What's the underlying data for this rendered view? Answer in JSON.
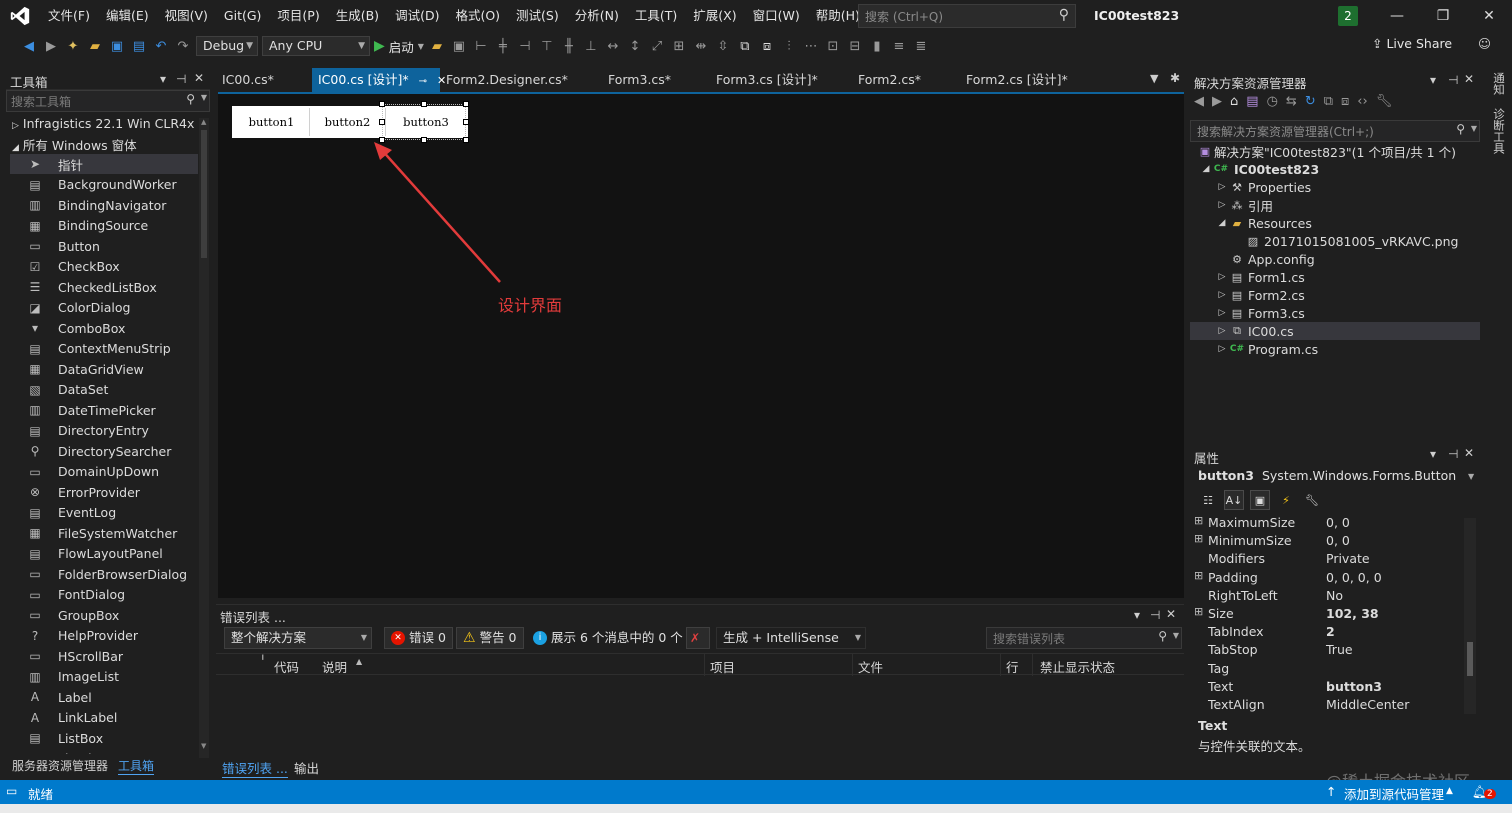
{
  "menu": {
    "items": [
      "文件(F)",
      "编辑(E)",
      "视图(V)",
      "Git(G)",
      "项目(P)",
      "生成(B)",
      "调试(D)",
      "格式(O)",
      "测试(S)",
      "分析(N)",
      "工具(T)",
      "扩展(X)",
      "窗口(W)",
      "帮助(H)"
    ],
    "search_placeholder": "搜索 (Ctrl+Q)",
    "solution_title": "IC00test823",
    "notification_count": "2"
  },
  "toolbar": {
    "config": "Debug",
    "platform": "Any CPU",
    "start_label": "启动",
    "live_share": "Live Share"
  },
  "toolbox": {
    "title": "工具箱",
    "search_placeholder": "搜索工具箱",
    "group_infragistics": "Infragistics 22.1 Win CLR4x",
    "group_windows": "所有 Windows 窗体",
    "items": [
      "指针",
      "BackgroundWorker",
      "BindingNavigator",
      "BindingSource",
      "Button",
      "CheckBox",
      "CheckedListBox",
      "ColorDialog",
      "ComboBox",
      "ContextMenuStrip",
      "DataGridView",
      "DataSet",
      "DateTimePicker",
      "DirectoryEntry",
      "DirectorySearcher",
      "DomainUpDown",
      "ErrorProvider",
      "EventLog",
      "FileSystemWatcher",
      "FlowLayoutPanel",
      "FolderBrowserDialog",
      "FontDialog",
      "GroupBox",
      "HelpProvider",
      "HScrollBar",
      "ImageList",
      "Label",
      "LinkLabel",
      "ListBox",
      "ListView"
    ],
    "tab_server": "服务器资源管理器",
    "tab_toolbox": "工具箱"
  },
  "tabs": [
    {
      "label": "IC00.cs*"
    },
    {
      "label": "IC00.cs [设计]*"
    },
    {
      "label": "Form2.Designer.cs*"
    },
    {
      "label": "Form3.cs*"
    },
    {
      "label": "Form3.cs [设计]*"
    },
    {
      "label": "Form2.cs*"
    },
    {
      "label": "Form2.cs [设计]*"
    }
  ],
  "designer": {
    "buttons": [
      "button1",
      "button2",
      "button3"
    ],
    "annotation": "设计界面"
  },
  "errorlist": {
    "title": "错误列表 ...",
    "scope": "整个解决方案",
    "errors": "错误 0",
    "warnings": "警告 0",
    "messages": "展示 6 个消息中的 0 个",
    "build_filter": "生成 + IntelliSense",
    "search_placeholder": "搜索错误列表",
    "columns": [
      "代码",
      "说明",
      "项目",
      "文件",
      "行",
      "禁止显示状态"
    ],
    "tab_errors": "错误列表 ...",
    "tab_output": "输出"
  },
  "solution_explorer": {
    "title": "解决方案资源管理器",
    "search_placeholder": "搜索解决方案资源管理器(Ctrl+;)",
    "solution_label": "解决方案\"IC00test823\"(1 个项目/共 1 个)",
    "project": "IC00test823",
    "nodes": [
      "Properties",
      "引用",
      "Resources",
      "20171015081005_vRKAVC.png",
      "App.config",
      "Form1.cs",
      "Form2.cs",
      "Form3.cs",
      "IC00.cs",
      "Program.cs"
    ]
  },
  "properties": {
    "title": "属性",
    "object_name": "button3",
    "object_type": "System.Windows.Forms.Button",
    "rows": [
      {
        "name": "MaximumSize",
        "value": "0, 0"
      },
      {
        "name": "MinimumSize",
        "value": "0, 0"
      },
      {
        "name": "Modifiers",
        "value": "Private"
      },
      {
        "name": "Padding",
        "value": "0, 0, 0, 0"
      },
      {
        "name": "RightToLeft",
        "value": "No"
      },
      {
        "name": "Size",
        "value": "102, 38"
      },
      {
        "name": "TabIndex",
        "value": "2"
      },
      {
        "name": "TabStop",
        "value": "True"
      },
      {
        "name": "Tag",
        "value": ""
      },
      {
        "name": "Text",
        "value": "button3"
      },
      {
        "name": "TextAlign",
        "value": "MiddleCenter"
      }
    ],
    "desc_title": "Text",
    "desc_text": "与控件关联的文本。"
  },
  "side_labels": {
    "top": "通知",
    "bottom": "诊断工具"
  },
  "statusbar": {
    "ready": "就绪",
    "source_control": "添加到源代码管理",
    "badge": "2"
  },
  "watermark": "@稀土掘金技术社区",
  "colors": {
    "accent": "#007acc",
    "active_tab": "#0e639c",
    "annotation_red": "#e23b3b"
  }
}
